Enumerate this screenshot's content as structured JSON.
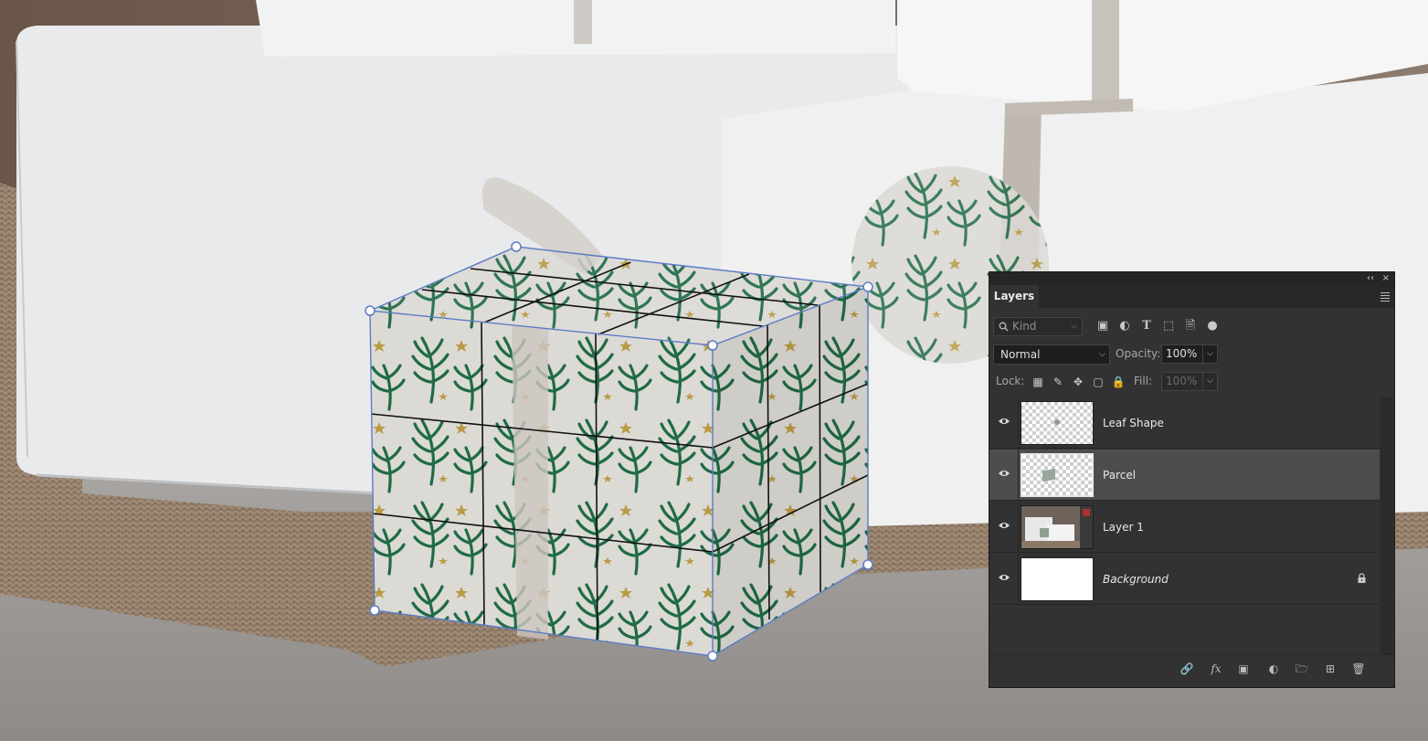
{
  "panel": {
    "tab_label": "Layers",
    "collapse_glyph": "‹‹",
    "close_glyph": "×",
    "filter": {
      "kind_placeholder": "Kind",
      "icons": [
        "image-filter-icon",
        "adjustment-filter-icon",
        "type-filter-icon",
        "shape-filter-icon",
        "smart-object-filter-icon",
        "filter-toggle-icon"
      ]
    },
    "blend_mode": "Normal",
    "opacity_label": "Opacity:",
    "opacity_value": "100%",
    "lock_label": "Lock:",
    "lock_icons": [
      "lock-transparent-icon",
      "lock-image-icon",
      "lock-position-icon",
      "lock-artboard-icon",
      "lock-all-icon"
    ],
    "fill_label": "Fill:",
    "fill_value": "100%",
    "layers": [
      {
        "name": "Leaf Shape",
        "visible": true,
        "selected": false
      },
      {
        "name": "Parcel",
        "visible": true,
        "selected": true
      },
      {
        "name": "Layer 1",
        "visible": true,
        "selected": false
      },
      {
        "name": "Background",
        "visible": true,
        "selected": false,
        "locked": true
      }
    ],
    "bottom_icons": [
      "link-layers-icon",
      "fx-icon",
      "add-mask-icon",
      "adjustment-layer-icon",
      "new-group-icon",
      "new-layer-icon",
      "delete-layer-icon"
    ]
  },
  "colors": {
    "panel_bg": "#323232",
    "selected_row": "#4d4d4d",
    "transform_handles": "#5c7cc4",
    "pattern_green": "#1f6b45"
  }
}
